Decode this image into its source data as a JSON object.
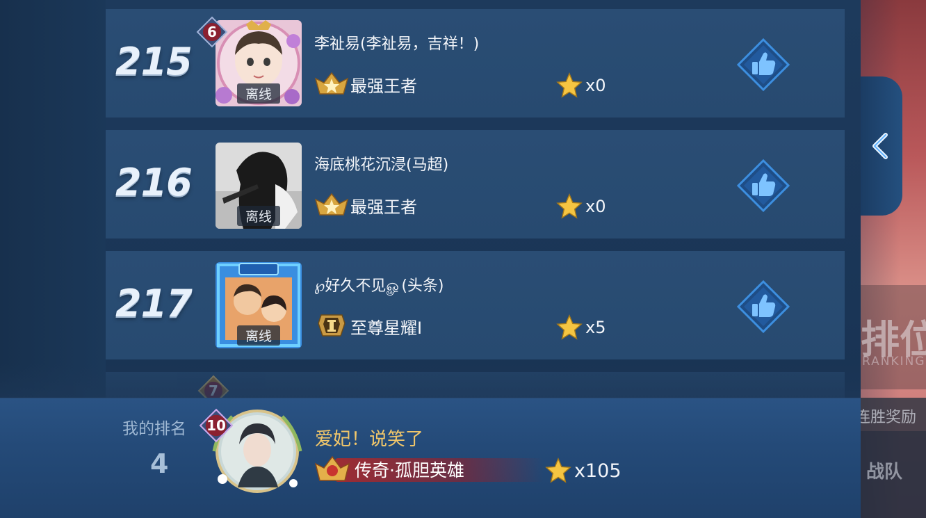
{
  "leaderboard": {
    "rows": [
      {
        "rank": "215",
        "name": "李祉易(李祉易，吉祥！)",
        "status": "离线",
        "level": "6",
        "tier": "最强王者",
        "stars": "x0"
      },
      {
        "rank": "216",
        "name": "海底桃花沉浸(马超)",
        "status": "离线",
        "tier": "最强王者",
        "stars": "x0"
      },
      {
        "rank": "217",
        "name": "℘好久不见ௐ(头条)",
        "status": "离线",
        "tier": "至尊星耀I",
        "stars": "x5"
      },
      {
        "level": "7"
      }
    ]
  },
  "my_rank": {
    "label": "我的排名",
    "rank": "4",
    "level": "10",
    "name": "爱妃！说笑了",
    "tier": "传奇·孤胆英雄",
    "stars": "x105"
  },
  "side_panel": {
    "rank_title": "排位",
    "rank_sub": "RANKING",
    "reward_label": "连胜奖励",
    "team_label": "战队"
  },
  "colors": {
    "row_bg": "#284b72",
    "my_name": "#f2c76a",
    "like_blue": "#2f7fd6"
  },
  "icons": {
    "like": "thumbs-up-icon",
    "star": "star-icon",
    "tier_king": "king-tier-icon",
    "tier_starlight": "starlight-tier-icon",
    "collapse": "chevron-left-icon"
  }
}
